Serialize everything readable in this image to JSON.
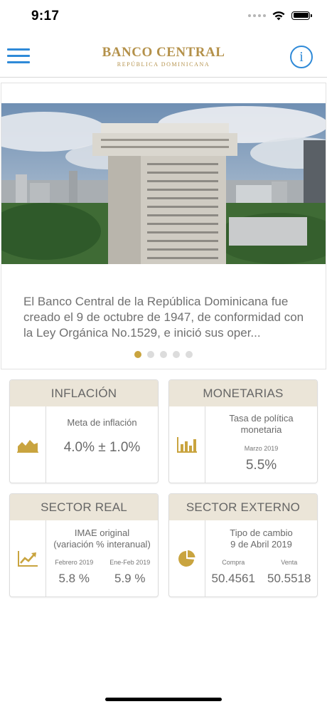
{
  "status_bar": {
    "time": "9:17",
    "icons": [
      "signal-icon",
      "wifi-icon",
      "battery-icon"
    ]
  },
  "header": {
    "menu_icon": "hamburger-menu-icon",
    "brand_title": "BANCO CENTRAL",
    "brand_subtitle": "REPÚBLICA DOMINICANA",
    "info_icon": "info-icon",
    "info_glyph": "i"
  },
  "carousel": {
    "text": "El Banco Central de la República Dominicana fue creado el 9 de octubre de 1947, de conformidad con la Ley Orgánica No.1529, e inició sus oper...",
    "page_count": 5,
    "active_page": 1
  },
  "cards": {
    "inflacion": {
      "title": "INFLACIÓN",
      "icon": "area-chart-icon",
      "label": "Meta de inflación",
      "value": "4.0% ± 1.0%"
    },
    "monetarias": {
      "title": "MONETARIAS",
      "icon": "bar-chart-icon",
      "label": "Tasa de política monetaria",
      "period": "Marzo 2019",
      "value": "5.5%"
    },
    "sector_real": {
      "title": "SECTOR REAL",
      "icon": "line-chart-icon",
      "label_line1": "IMAE original",
      "label_line2": "(variación % interanual)",
      "col1_period": "Febrero 2019",
      "col1_value": "5.8 %",
      "col2_period": "Ene-Feb 2019",
      "col2_value": "5.9 %"
    },
    "sector_externo": {
      "title": "SECTOR EXTERNO",
      "icon": "pie-chart-icon",
      "label_line1": "Tipo de cambio",
      "label_line2": "9 de Abril 2019",
      "col1_label": "Compra",
      "col1_value": "50.4561",
      "col2_label": "Venta",
      "col2_value": "50.5518"
    }
  },
  "colors": {
    "accent_blue": "#2f8ad8",
    "gold": "#b4914a",
    "card_header_bg": "#ebe5d8",
    "dot_active": "#c9a43f"
  }
}
